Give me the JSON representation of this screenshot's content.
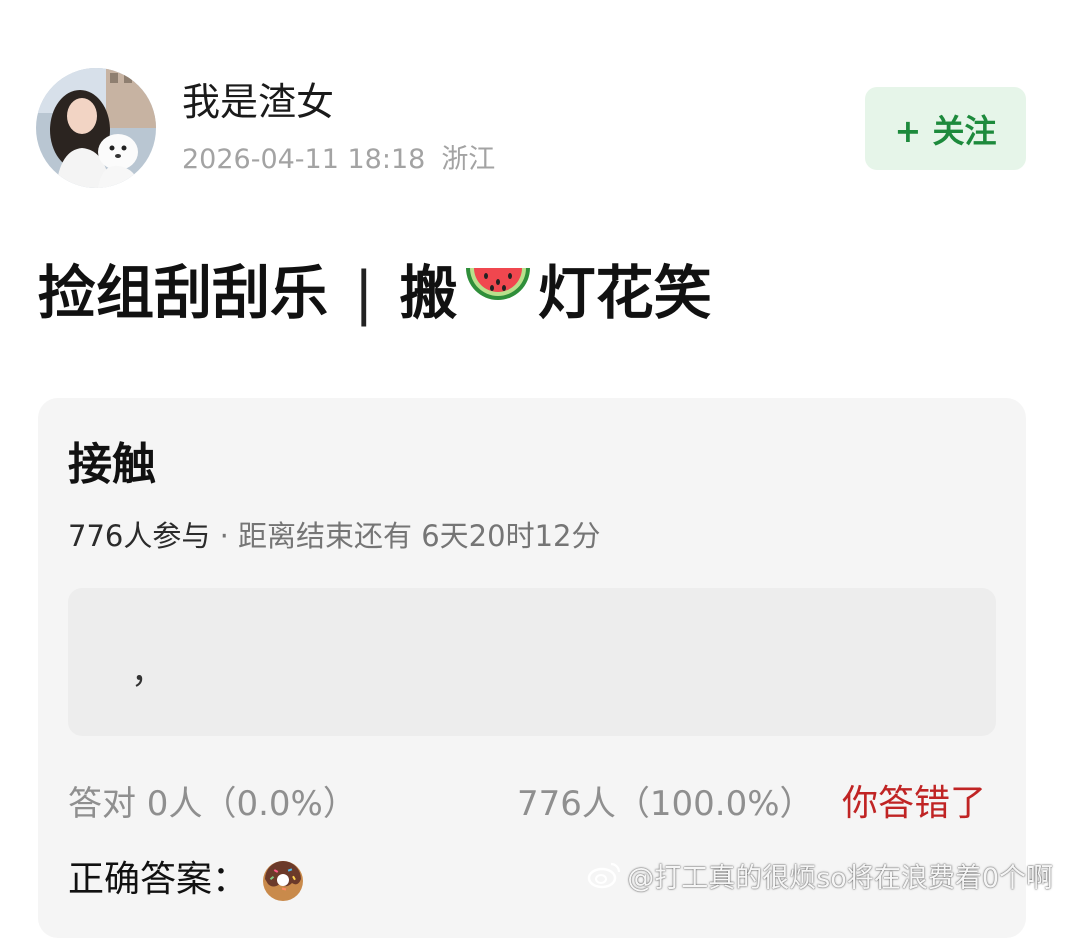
{
  "post": {
    "author_name": "我是渣女",
    "timestamp": "2026-04-11 18:18",
    "location": "浙江",
    "follow_label": "+ 关注",
    "title_left": "捡组刮刮乐",
    "title_separator": "|",
    "title_prefix": "搬",
    "title_suffix": "灯花笑",
    "title_emoji": "watermelon-emoji"
  },
  "poll": {
    "title": "接触",
    "participants": "776人参与",
    "separator": "·",
    "deadline": "距离结束还有 6天20时12分",
    "option_text": "，",
    "correct_stat": "答对  0人（0.0%）",
    "wrong_stat": "776人（100.0%）",
    "result": "你答错了",
    "answer_label": "正确答案：",
    "answer_emoji": "donut-emoji"
  },
  "watermark": {
    "text": "@打工真的很烦so将在浪费着0个啊"
  },
  "colors": {
    "follow_bg": "#e6f5e9",
    "follow_text": "#1d8a3c",
    "wrong_text": "#c02424",
    "card_bg": "#f5f5f5"
  }
}
